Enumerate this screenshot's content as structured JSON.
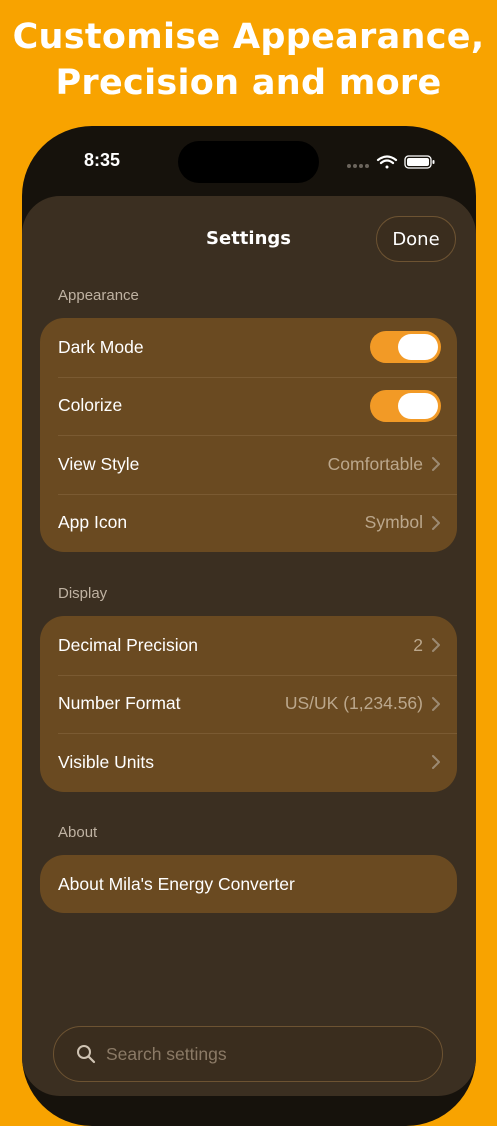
{
  "headline": {
    "line1": "Customise Appearance,",
    "line2": "Precision and more"
  },
  "status_bar": {
    "time": "8:35"
  },
  "nav": {
    "title": "Settings",
    "done_label": "Done"
  },
  "sections": {
    "appearance": {
      "header": "Appearance",
      "dark_mode": {
        "label": "Dark Mode",
        "on": true
      },
      "colorize": {
        "label": "Colorize",
        "on": true
      },
      "view_style": {
        "label": "View Style",
        "value": "Comfortable"
      },
      "app_icon": {
        "label": "App Icon",
        "value": "Symbol"
      }
    },
    "display": {
      "header": "Display",
      "decimal_precision": {
        "label": "Decimal Precision",
        "value": "2"
      },
      "number_format": {
        "label": "Number Format",
        "value": "US/UK (1,234.56)"
      },
      "visible_units": {
        "label": "Visible Units"
      }
    },
    "about": {
      "header": "About",
      "about_app": {
        "label": "About Mila's Energy Converter"
      }
    }
  },
  "search": {
    "placeholder": "Search settings"
  },
  "colors": {
    "background": "#F8A300",
    "sheet": "#3b2f21",
    "group": "#6a4a21",
    "accent": "#f29a26"
  }
}
